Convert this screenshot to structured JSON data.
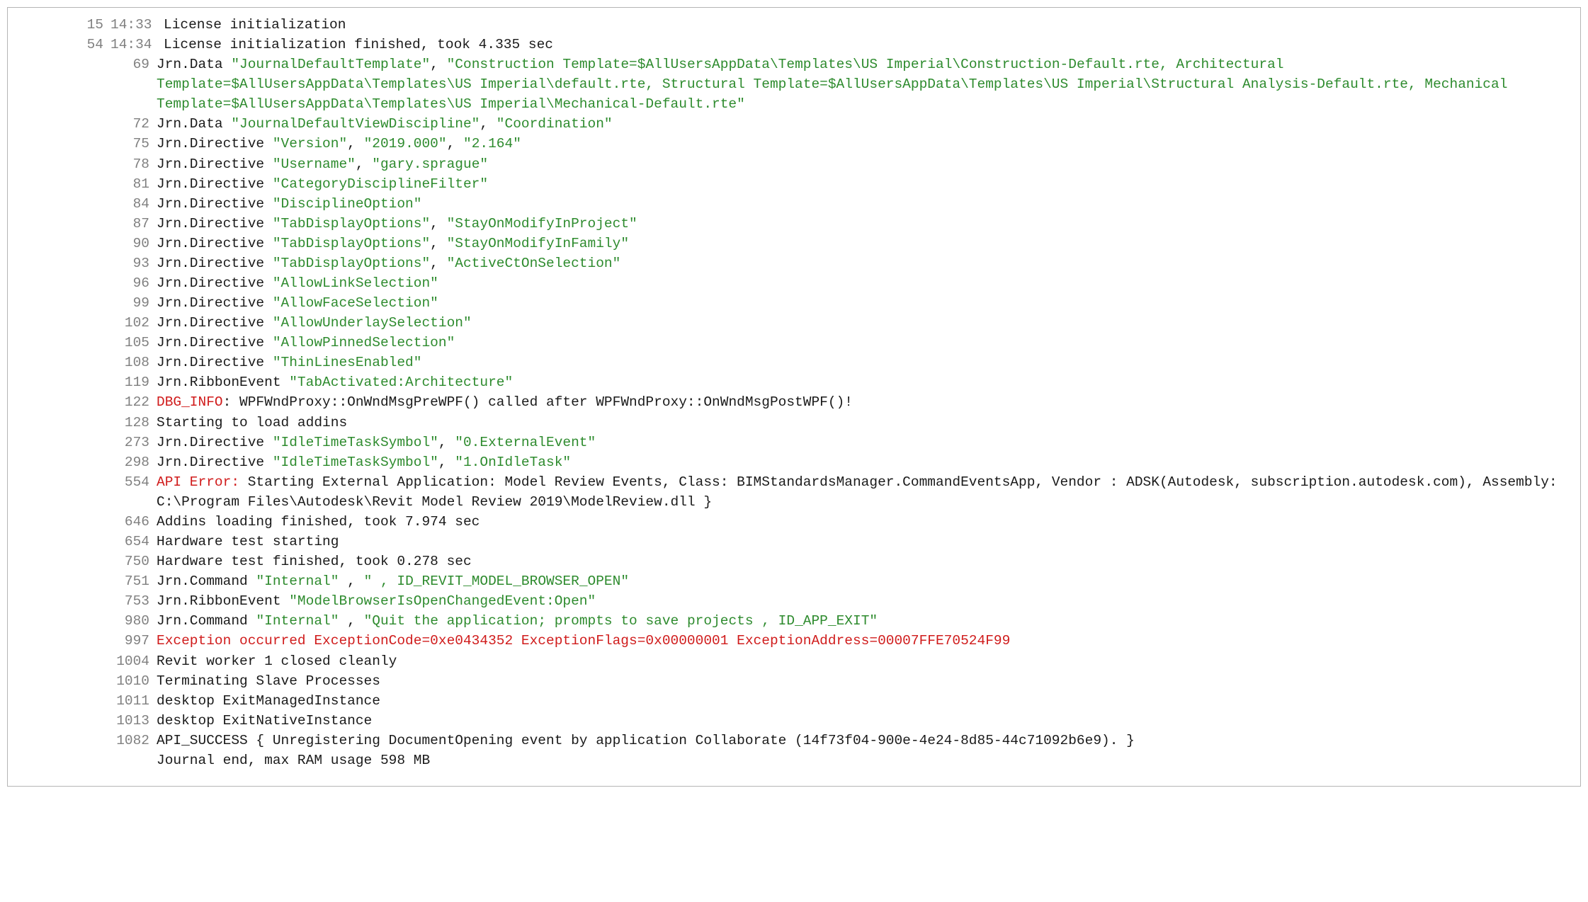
{
  "lines": [
    {
      "n": "15",
      "t": "14:33",
      "layout": "t1",
      "segs": [
        {
          "txt": "License initialization"
        }
      ]
    },
    {
      "n": "54",
      "t": "14:34",
      "layout": "t1",
      "segs": [
        {
          "txt": "License initialization finished, took 4.335 sec"
        }
      ]
    },
    {
      "n": "69",
      "layout": "i2",
      "segs": [
        {
          "txt": "Jrn.Data "
        },
        {
          "cls": "s",
          "txt": "\"JournalDefaultTemplate\""
        },
        {
          "txt": ", "
        },
        {
          "cls": "s",
          "txt": "\"Construction Template=$AllUsersAppData\\Templates\\US Imperial\\Construction-Default.rte, Architectural Template=$AllUsersAppData\\Templates\\US Imperial\\default.rte, Structural Template=$AllUsersAppData\\Templates\\US Imperial\\Structural Analysis-Default.rte, Mechanical Template=$AllUsersAppData\\Templates\\US Imperial\\Mechanical-Default.rte\""
        }
      ]
    },
    {
      "n": "72",
      "layout": "i2",
      "segs": [
        {
          "txt": "Jrn.Data "
        },
        {
          "cls": "s",
          "txt": "\"JournalDefaultViewDiscipline\""
        },
        {
          "txt": ", "
        },
        {
          "cls": "s",
          "txt": "\"Coordination\""
        }
      ]
    },
    {
      "n": "75",
      "layout": "i2",
      "segs": [
        {
          "txt": "Jrn.Directive "
        },
        {
          "cls": "s",
          "txt": "\"Version\""
        },
        {
          "txt": ", "
        },
        {
          "cls": "s",
          "txt": "\"2019.000\""
        },
        {
          "txt": ", "
        },
        {
          "cls": "s",
          "txt": "\"2.164\""
        }
      ]
    },
    {
      "n": "78",
      "layout": "i2",
      "segs": [
        {
          "txt": "Jrn.Directive "
        },
        {
          "cls": "s",
          "txt": "\"Username\""
        },
        {
          "txt": ", "
        },
        {
          "cls": "s",
          "txt": "\"gary.sprague\""
        }
      ]
    },
    {
      "n": "81",
      "layout": "i2",
      "segs": [
        {
          "txt": "Jrn.Directive "
        },
        {
          "cls": "s",
          "txt": "\"CategoryDisciplineFilter\""
        }
      ]
    },
    {
      "n": "84",
      "layout": "i2",
      "segs": [
        {
          "txt": "Jrn.Directive "
        },
        {
          "cls": "s",
          "txt": "\"DisciplineOption\""
        }
      ]
    },
    {
      "n": "87",
      "layout": "i2",
      "segs": [
        {
          "txt": "Jrn.Directive "
        },
        {
          "cls": "s",
          "txt": "\"TabDisplayOptions\""
        },
        {
          "txt": ", "
        },
        {
          "cls": "s",
          "txt": "\"StayOnModifyInProject\""
        }
      ]
    },
    {
      "n": "90",
      "layout": "i2",
      "segs": [
        {
          "txt": "Jrn.Directive "
        },
        {
          "cls": "s",
          "txt": "\"TabDisplayOptions\""
        },
        {
          "txt": ", "
        },
        {
          "cls": "s",
          "txt": "\"StayOnModifyInFamily\""
        }
      ]
    },
    {
      "n": "93",
      "layout": "i2",
      "segs": [
        {
          "txt": "Jrn.Directive "
        },
        {
          "cls": "s",
          "txt": "\"TabDisplayOptions\""
        },
        {
          "txt": ", "
        },
        {
          "cls": "s",
          "txt": "\"ActiveCtOnSelection\""
        }
      ]
    },
    {
      "n": "96",
      "layout": "i2",
      "segs": [
        {
          "txt": "Jrn.Directive "
        },
        {
          "cls": "s",
          "txt": "\"AllowLinkSelection\""
        }
      ]
    },
    {
      "n": "99",
      "layout": "i2",
      "segs": [
        {
          "txt": "Jrn.Directive "
        },
        {
          "cls": "s",
          "txt": "\"AllowFaceSelection\""
        }
      ]
    },
    {
      "n": "102",
      "layout": "i2",
      "segs": [
        {
          "txt": "Jrn.Directive "
        },
        {
          "cls": "s",
          "txt": "\"AllowUnderlaySelection\""
        }
      ]
    },
    {
      "n": "105",
      "layout": "i2",
      "segs": [
        {
          "txt": "Jrn.Directive "
        },
        {
          "cls": "s",
          "txt": "\"AllowPinnedSelection\""
        }
      ]
    },
    {
      "n": "108",
      "layout": "i2",
      "segs": [
        {
          "txt": "Jrn.Directive "
        },
        {
          "cls": "s",
          "txt": "\"ThinLinesEnabled\""
        }
      ]
    },
    {
      "n": "119",
      "layout": "i2",
      "segs": [
        {
          "txt": "Jrn.RibbonEvent "
        },
        {
          "cls": "s",
          "txt": "\"TabActivated:Architecture\""
        }
      ]
    },
    {
      "n": "122",
      "layout": "i2",
      "segs": [
        {
          "cls": "svc",
          "txt": "DBG_INFO"
        },
        {
          "txt": ": WPFWndProxy::OnWndMsgPreWPF() called after WPFWndProxy::OnWndMsgPostWPF()!"
        }
      ]
    },
    {
      "n": "128",
      "layout": "i2",
      "segs": [
        {
          "txt": "Starting to load addins"
        }
      ]
    },
    {
      "n": "273",
      "layout": "i2",
      "segs": [
        {
          "txt": "Jrn.Directive "
        },
        {
          "cls": "s",
          "txt": "\"IdleTimeTaskSymbol\""
        },
        {
          "txt": ", "
        },
        {
          "cls": "s",
          "txt": "\"0.ExternalEvent\""
        }
      ]
    },
    {
      "n": "298",
      "layout": "i2",
      "segs": [
        {
          "txt": "Jrn.Directive "
        },
        {
          "cls": "s",
          "txt": "\"IdleTimeTaskSymbol\""
        },
        {
          "txt": ", "
        },
        {
          "cls": "s",
          "txt": "\"1.OnIdleTask\""
        }
      ]
    },
    {
      "n": "554",
      "layout": "i2",
      "segs": [
        {
          "cls": "err",
          "txt": "API Error:"
        },
        {
          "txt": " Starting External Application: Model Review Events, Class: BIMStandardsManager.CommandEventsApp, Vendor : ADSK(Autodesk, subscription.autodesk.com), Assembly: C:\\Program Files\\Autodesk\\Revit Model Review 2019\\ModelReview.dll }"
        }
      ]
    },
    {
      "n": "646",
      "layout": "i2",
      "segs": [
        {
          "txt": "Addins loading finished, took 7.974 sec"
        }
      ]
    },
    {
      "n": "654",
      "layout": "i2",
      "segs": [
        {
          "txt": "Hardware test starting"
        }
      ]
    },
    {
      "n": "750",
      "layout": "i2",
      "segs": [
        {
          "txt": "Hardware test finished, took 0.278 sec"
        }
      ]
    },
    {
      "n": "751",
      "layout": "i2",
      "segs": [
        {
          "txt": "Jrn.Command "
        },
        {
          "cls": "s",
          "txt": "\"Internal\""
        },
        {
          "txt": " , "
        },
        {
          "cls": "s",
          "txt": "\" , ID_REVIT_MODEL_BROWSER_OPEN\""
        }
      ]
    },
    {
      "n": "753",
      "layout": "i2",
      "segs": [
        {
          "txt": "Jrn.RibbonEvent "
        },
        {
          "cls": "s",
          "txt": "\"ModelBrowserIsOpenChangedEvent:Open\""
        }
      ]
    },
    {
      "n": "980",
      "layout": "i2",
      "segs": [
        {
          "txt": "Jrn.Command "
        },
        {
          "cls": "s",
          "txt": "\"Internal\""
        },
        {
          "txt": " , "
        },
        {
          "cls": "s",
          "txt": "\"Quit the application; prompts to save projects , ID_APP_EXIT\""
        }
      ]
    },
    {
      "n": "997",
      "layout": "i2",
      "segs": [
        {
          "cls": "err",
          "txt": "Exception occurred ExceptionCode=0xe0434352 ExceptionFlags=0x00000001 ExceptionAddress=00007FFE70524F99"
        }
      ]
    },
    {
      "n": "1004",
      "layout": "i2",
      "segs": [
        {
          "txt": "Revit worker 1 closed cleanly"
        }
      ]
    },
    {
      "n": "1010",
      "layout": "i2",
      "segs": [
        {
          "txt": "Terminating Slave Processes"
        }
      ]
    },
    {
      "n": "1011",
      "layout": "i2",
      "segs": [
        {
          "txt": "desktop ExitManagedInstance"
        }
      ]
    },
    {
      "n": "1013",
      "layout": "i2",
      "segs": [
        {
          "txt": "desktop ExitNativeInstance"
        }
      ]
    },
    {
      "n": "1082",
      "layout": "i2",
      "segs": [
        {
          "txt": "API_SUCCESS { Unregistering DocumentOpening event by application Collaborate (14f73f04-900e-4e24-8d85-44c71092b6e9). }"
        }
      ]
    },
    {
      "n": "",
      "layout": "i2",
      "segs": [
        {
          "txt": "Journal end, max RAM usage 598 MB"
        }
      ]
    }
  ]
}
